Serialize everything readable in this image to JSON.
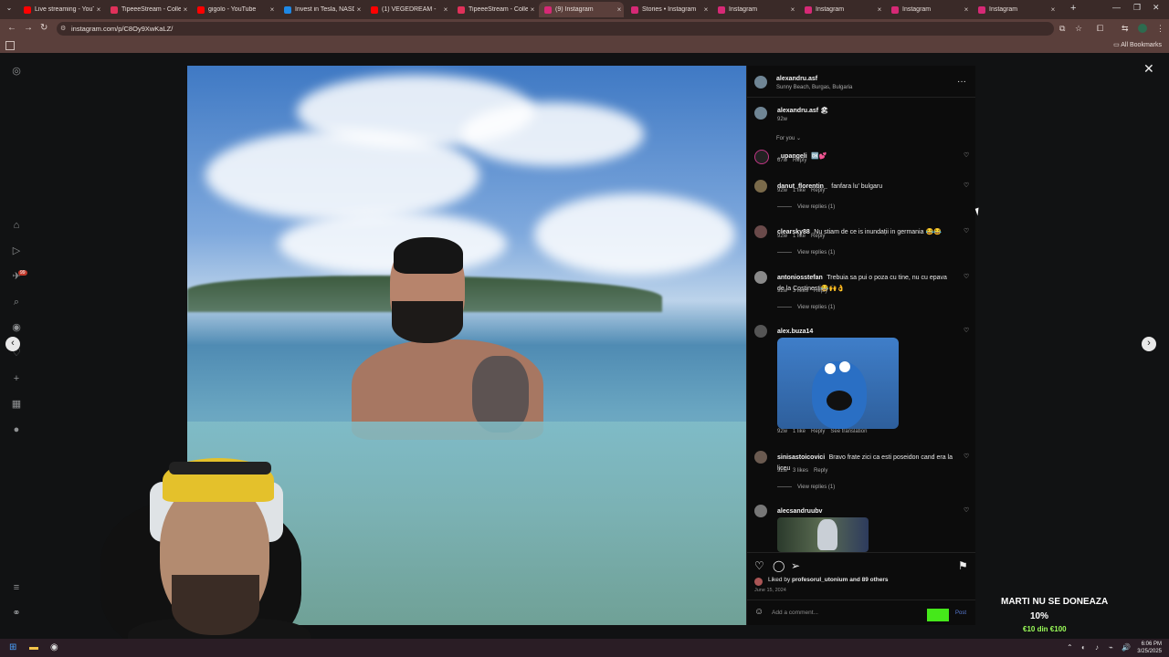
{
  "browser": {
    "tabs": [
      {
        "label": "Live streaming - YouTu",
        "color": "#ff0000"
      },
      {
        "label": "TipeeeStream - Collect",
        "color": "#e0315a"
      },
      {
        "label": "gigolo - YouTube",
        "color": "#ff0000"
      },
      {
        "label": "Invest in Tesla, NASDA",
        "color": "#1e88e5"
      },
      {
        "label": "(1) VEGEDREAM -",
        "color": "#ff0000"
      },
      {
        "label": "TipeeeStream - Collect",
        "color": "#e0315a"
      },
      {
        "label": "(9) Instagram",
        "color": "#d62976"
      },
      {
        "label": "Stories • Instagram",
        "color": "#d62976"
      },
      {
        "label": "Instagram",
        "color": "#d62976"
      },
      {
        "label": "Instagram",
        "color": "#d62976"
      },
      {
        "label": "Instagram",
        "color": "#d62976"
      },
      {
        "label": "Instagram",
        "color": "#d62976"
      }
    ],
    "active_tab": 6,
    "url": "instagram.com/p/C8Oy9XwKaLZ/",
    "all_bookmarks": "All Bookmarks"
  },
  "post": {
    "author": "alexandru.asf",
    "location": "Sunny Beach, Burgas, Bulgaria",
    "caption_user": "alexandru.asf",
    "caption_emoji": "🏖",
    "caption_age": "92w",
    "for_you": "For you",
    "comments": [
      {
        "user": "_upangeli",
        "text": "🆗💕",
        "age": "67w",
        "likes": "",
        "reply": "Reply",
        "view_replies": ""
      },
      {
        "user": "danut_florentin_",
        "text": "fanfara lu' bulgaru",
        "age": "92w",
        "likes": "1 like",
        "reply": "Reply",
        "view_replies": "View replies (1)"
      },
      {
        "user": "clearsky88",
        "text": "Nu stiam de ce is inundații in germania 😂😂",
        "age": "92w",
        "likes": "1 like",
        "reply": "Reply",
        "view_replies": "View replies (1)"
      },
      {
        "user": "antoniosstefan",
        "text": "Trebuia sa pui o poza cu tine, nu cu epava de la Costinesti😂🙌👌",
        "age": "92w",
        "likes": "3 likes",
        "reply": "Reply",
        "view_replies": "View replies (1)"
      },
      {
        "user": "alex.buza14",
        "text": "",
        "age": "92w",
        "likes": "1 like",
        "reply": "Reply",
        "extra": "See translation",
        "view_replies": ""
      },
      {
        "user": "sinisastoicovici",
        "text": "Bravo frate zici ca esti poseidon cand era la liceu",
        "age": "92w",
        "likes": "3 likes",
        "reply": "Reply",
        "view_replies": "View replies (1)"
      },
      {
        "user": "alecsandruubv",
        "text": "",
        "age": "",
        "likes": "",
        "reply": "",
        "view_replies": ""
      }
    ],
    "liked_by_prefix": "Liked by",
    "liked_by_user": "profesorul_utonium",
    "liked_by_suffix": "and 89 others",
    "date": "June 15, 2024",
    "add_comment_placeholder": "Add a comment...",
    "post_label": "Post"
  },
  "overlay": {
    "title": "MARTI NU SE DONEAZA",
    "percent": "10%",
    "amount": "€10 din €100",
    "progress": 0.1
  },
  "taskbar": {
    "time": "6:06 PM",
    "date": "3/25/2025"
  },
  "icons": {
    "close": "close-icon",
    "more": "more-icon",
    "heart": "heart-icon",
    "comment": "comment-icon",
    "share": "share-icon",
    "save": "bookmark-icon"
  }
}
